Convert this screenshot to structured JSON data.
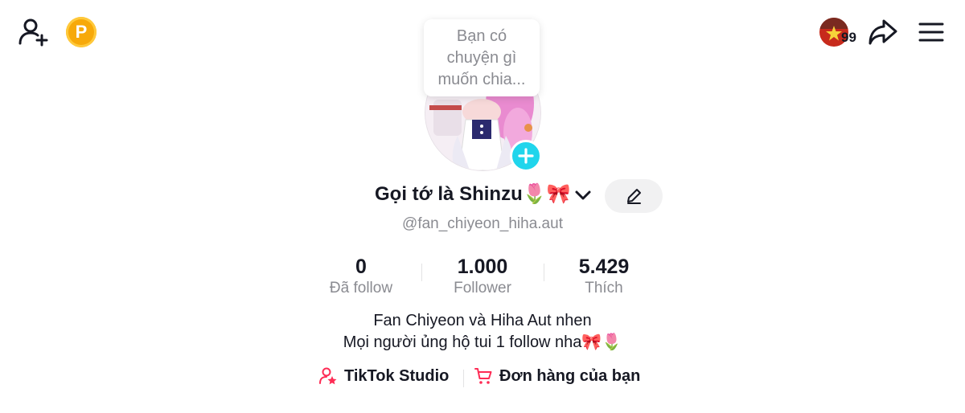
{
  "topbar": {
    "coin_letter": "P",
    "badge_count": "99",
    "icons": [
      "add-friend-icon",
      "coin-icon",
      "flag-avatar",
      "share-icon",
      "menu-icon"
    ]
  },
  "tooltip": {
    "text": "Bạn có chuyện gì muốn chia..."
  },
  "profile": {
    "display_name": "Gọi tớ là Shinzu🌷🎀",
    "username": "@fan_chiyeon_hiha.aut"
  },
  "stats": [
    {
      "value": "0",
      "label": "Đã follow"
    },
    {
      "value": "1.000",
      "label": "Follower"
    },
    {
      "value": "5.429",
      "label": "Thích"
    }
  ],
  "bio": {
    "line1": "Fan Chiyeon và Hiha Aut nhen",
    "line2": "Mọi người ủng hộ tui 1 follow nha🎀🌷"
  },
  "links": {
    "studio": "TikTok Studio",
    "orders": "Đơn hàng của bạn"
  },
  "colors": {
    "accent_cyan": "#20d5ec",
    "brand_pink": "#fe2c55",
    "secondary_text": "#8a8b91",
    "coin_gold": "#f7a90a"
  }
}
